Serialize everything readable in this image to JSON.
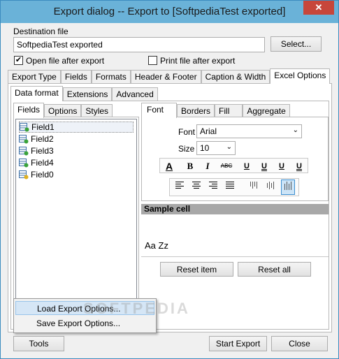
{
  "window": {
    "title": "Export dialog -- Export to [SoftpediaTest exported]",
    "close_glyph": "✕"
  },
  "destination": {
    "label": "Destination file",
    "value": "SoftpediaTest exported",
    "select_button": "Select...",
    "open_after_export": {
      "label": "Open file after export",
      "checked": true,
      "mark": "✔"
    },
    "print_after_export": {
      "label": "Print file after export",
      "checked": false,
      "mark": ""
    }
  },
  "main_tabs": [
    "Export Type",
    "Fields",
    "Formats",
    "Header & Footer",
    "Caption & Width",
    "Excel Options"
  ],
  "sub_tabs": [
    "Data format",
    "Extensions",
    "Advanced"
  ],
  "left_tabs": [
    "Fields",
    "Options",
    "Styles"
  ],
  "fields": [
    "Field1",
    "Field2",
    "Field3",
    "Field4",
    "Field0"
  ],
  "right_tabs": [
    "Font",
    "Borders",
    "Fill",
    "Aggregate"
  ],
  "font": {
    "font_label": "Font",
    "font_value": "Arial",
    "size_label": "Size",
    "size_value": "10",
    "dropdown_glyph": "⌄"
  },
  "toolbar": {
    "color_glyph": "A",
    "bold_glyph": "B",
    "italic_glyph": "I",
    "strike_glyph": "ABC",
    "underline_glyphs": [
      "U",
      "U",
      "U",
      "U"
    ]
  },
  "sample": {
    "header": "Sample cell",
    "text": "Aa Zz"
  },
  "buttons": {
    "reset_item": "Reset item",
    "reset_all": "Reset all",
    "tools": "Tools",
    "start_export": "Start Export",
    "close": "Close"
  },
  "tools_menu": [
    "Load Export Options...",
    "Save Export Options..."
  ],
  "watermark": "SOFTPEDIA"
}
